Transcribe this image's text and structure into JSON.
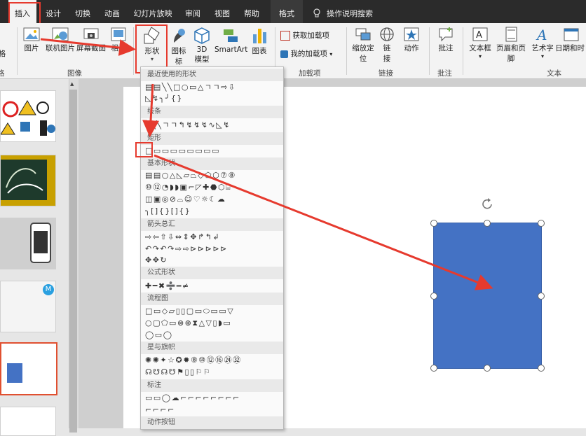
{
  "tabs": [
    {
      "label": "插入",
      "active": true
    },
    {
      "label": "设计"
    },
    {
      "label": "切换"
    },
    {
      "label": "动画"
    },
    {
      "label": "幻灯片放映"
    },
    {
      "label": "审阅"
    },
    {
      "label": "视图"
    },
    {
      "label": "帮助"
    },
    {
      "label": "格式"
    }
  ],
  "tell_me": "操作说明搜索",
  "ribbon": {
    "images": {
      "label": "图片",
      "online": "联机图片",
      "screenshot": "屏幕截图",
      "album": "相册",
      "group": "图像"
    },
    "illustrations": {
      "shapes": "形状",
      "icons": "图标",
      "model3d_1": "3D",
      "model3d_2": "模型",
      "smartart": "SmartArt",
      "chart": "图表"
    },
    "addins": {
      "get": "获取加载项",
      "mine": "我的加载项",
      "group": "加载项"
    },
    "links": {
      "zoom_1": "缩放定",
      "zoom_2": "位",
      "link_1": "链",
      "link_2": "接",
      "action": "动作",
      "group": "链接"
    },
    "comments": {
      "comment": "批注",
      "group": "批注"
    },
    "text": {
      "textbox": "文本框",
      "header": "页眉和页脚",
      "wordart": "艺术字",
      "datetime": "日期和时",
      "group": "文本"
    },
    "left_cut": {
      "a": "格",
      "b": "格"
    }
  },
  "gallery": {
    "sections": [
      {
        "title": "最近使用的形状",
        "rows": [
          "▤▤╲╲□○▭△ㄱㄱ⇨⇩",
          "◺↯╮╯{}"
        ]
      },
      {
        "title": "线条",
        "rows": [
          "╲╲╲ㄱㄱ↰↯↯↯∿◺↯"
        ]
      },
      {
        "title": "矩形",
        "rows": [
          "□▭▭▭▭▭▭▭▭"
        ]
      },
      {
        "title": "基本形状",
        "rows": [
          "▤▤○△◺▱⏢◇⬠⬡⑦⑧",
          "⑩⑫◔◗◗▣⌐◸✚⬣⬡⌸",
          "◫▣◎⊘⌓☺♡☼☾☁",
          "╮[]{}[]{}"
        ]
      },
      {
        "title": "箭头总汇",
        "rows": [
          "⇨⇦⇧⇩⇔⇕✥↱↰↲",
          "↶↷↶↷⇨⇨⊳⊳⊳⊳⊳",
          "✥✥↻"
        ]
      },
      {
        "title": "公式形状",
        "rows": [
          "✚━✖➗═≠"
        ]
      },
      {
        "title": "流程图",
        "rows": [
          "□▭◇▱▯▯▢▭⬭▭▭▽",
          "○▢⬠▭⊗⊕⧗△▽▯◗▭",
          "◯▭◯"
        ]
      },
      {
        "title": "星与旗帜",
        "rows": [
          "✺✺✦☆✪✹⑧⑩⑫⑯㉔㉜",
          "☊☋☊☋⚑▯▯⚐⚐"
        ]
      },
      {
        "title": "标注",
        "rows": [
          "▭▭◯☁⌐⌐⌐⌐⌐⌐⌐⌐",
          "⌐⌐⌐⌐"
        ]
      },
      {
        "title": "动作按钮",
        "rows": []
      }
    ]
  },
  "thumb_badge": "M",
  "colors": {
    "accent": "#e63a2e",
    "shape_fill": "#4472c4",
    "tabbar": "#2b2b2b",
    "ribbon": "#f3f3f3"
  }
}
